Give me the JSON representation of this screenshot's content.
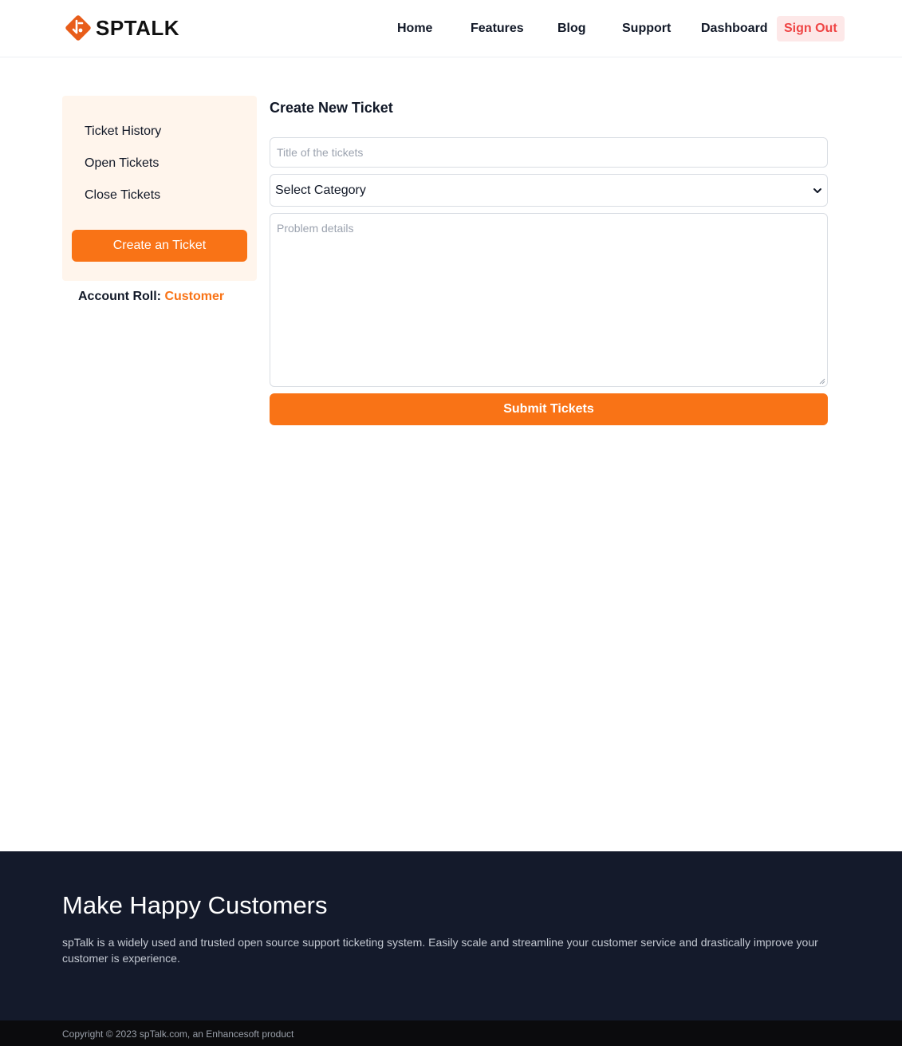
{
  "brand": {
    "name": "SPTALK",
    "accent_color": "#f97316"
  },
  "nav": {
    "items": [
      {
        "label": "Home"
      },
      {
        "label": "Features"
      },
      {
        "label": "Blog"
      },
      {
        "label": "Support"
      },
      {
        "label": "Dashboard"
      }
    ],
    "signout_label": "Sign Out"
  },
  "sidebar": {
    "links": [
      {
        "label": "Ticket History"
      },
      {
        "label": "Open Tickets"
      },
      {
        "label": "Close Tickets"
      }
    ],
    "create_button": "Create an Ticket",
    "account_roll_label": "Account Roll:",
    "account_roll_value": "Customer"
  },
  "form": {
    "title": "Create New Ticket",
    "title_placeholder": "Title of the tickets",
    "category_selected": "Select Category",
    "details_placeholder": "Problem details",
    "submit_label": "Submit Tickets"
  },
  "footer": {
    "title": "Make Happy Customers",
    "description": "spTalk is a widely used and trusted open source support ticketing system. Easily scale and streamline your customer service and drastically improve your customer is experience.",
    "copyright": "Copyright © 2023 spTalk.com, an Enhancesoft product"
  }
}
